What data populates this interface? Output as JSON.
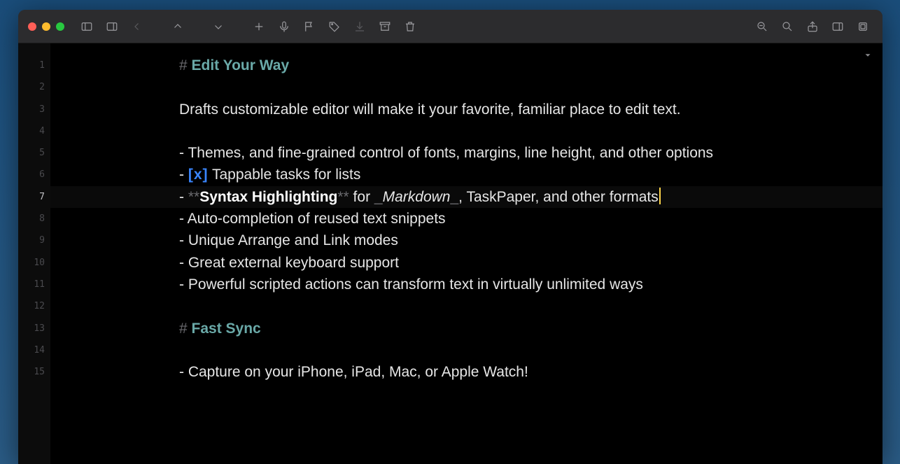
{
  "toolbar": {
    "icons": [
      "sidebar-left",
      "sidebar-right",
      "back",
      "up",
      "down",
      "plus",
      "mic",
      "flag",
      "tag",
      "download",
      "archive",
      "trash",
      "zoom-out",
      "search",
      "share",
      "panel-right",
      "inspector"
    ]
  },
  "colors": {
    "heading": "#6aa9a8",
    "task_bracket": "#3a86ff",
    "cursor": "#ffd54a",
    "markdown_mark": "#6a6a6e",
    "text": "#e6e6e6"
  },
  "active_line": 7,
  "lines": {
    "l1_mark": "# ",
    "l1_heading": "Edit Your Way",
    "l3_text": "Drafts customizable editor will make it your favorite, familiar place to edit text.",
    "l5_bullet": "- ",
    "l5_text": "Themes, and fine-grained control of fonts, margins, line height, and other options",
    "l6_bullet": "- ",
    "l6_task": "[x]",
    "l6_text": " Tappable tasks for lists",
    "l7_bullet": "- ",
    "l7_bold_open": "**",
    "l7_bold_text": "Syntax Highlighting",
    "l7_bold_close": "**",
    "l7_mid1": " for ",
    "l7_it_open": "_",
    "l7_it_text": "Markdown",
    "l7_it_close": "_",
    "l7_tail": ", TaskPaper, and other formats",
    "l8_bullet": "- ",
    "l8_text": "Auto-completion of reused text snippets",
    "l9_bullet": "- ",
    "l9_text": "Unique Arrange and Link modes",
    "l10_bullet": "- ",
    "l10_text": "Great external keyboard support",
    "l11_bullet": "- ",
    "l11_text": "Powerful scripted actions can transform text in virtually unlimited ways",
    "l13_mark": "# ",
    "l13_heading": "Fast Sync",
    "l15_bullet": "- ",
    "l15_text": "Capture on your iPhone, iPad, Mac, or Apple Watch!"
  },
  "line_numbers": [
    "1",
    "2",
    "3",
    "4",
    "5",
    "6",
    "7",
    "8",
    "9",
    "10",
    "11",
    "12",
    "13",
    "14",
    "15"
  ]
}
